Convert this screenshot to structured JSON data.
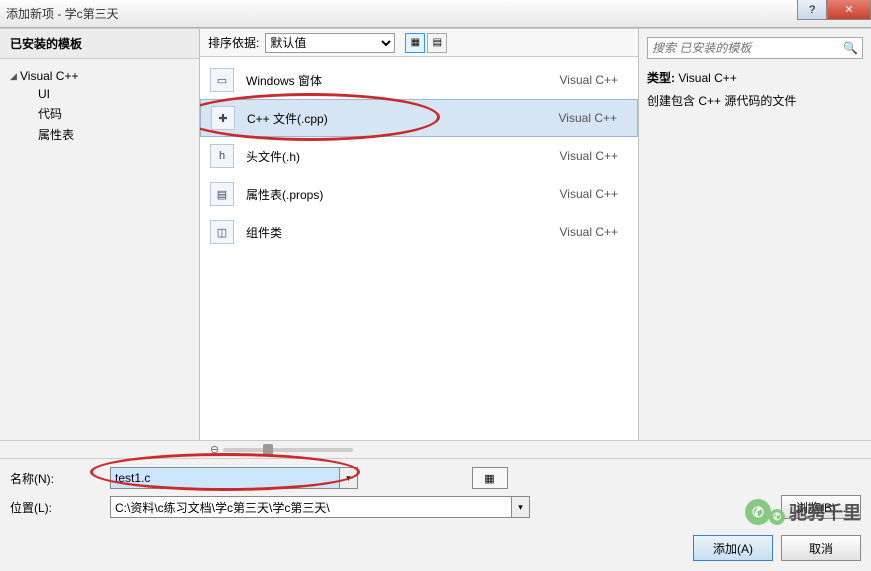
{
  "window": {
    "title": "添加新项 - 学c第三天"
  },
  "sidebar": {
    "header": "已安装的模板",
    "root": "Visual C++",
    "items": [
      {
        "label": "UI"
      },
      {
        "label": "代码"
      },
      {
        "label": "属性表"
      }
    ]
  },
  "toolbar": {
    "sort_label": "排序依据:",
    "sort_value": "默认值"
  },
  "templates": [
    {
      "icon": "▭",
      "label": "Windows 窗体",
      "lang": "Visual C++"
    },
    {
      "icon": "✚",
      "label": "C++ 文件(.cpp)",
      "lang": "Visual C++",
      "selected": true
    },
    {
      "icon": "h",
      "label": "头文件(.h)",
      "lang": "Visual C++"
    },
    {
      "icon": "▤",
      "label": "属性表(.props)",
      "lang": "Visual C++"
    },
    {
      "icon": "◫",
      "label": "组件类",
      "lang": "Visual C++"
    }
  ],
  "detail": {
    "search_placeholder": "搜索 已安装的模板",
    "type_label": "类型:",
    "type_value": "Visual C++",
    "description": "创建包含 C++ 源代码的文件"
  },
  "form": {
    "name_label": "名称(N):",
    "name_value": "test1.c",
    "location_label": "位置(L):",
    "location_value": "C:\\资料\\c练习文档\\学c第三天\\学c第三天\\",
    "browse_label": "浏览(B)..."
  },
  "buttons": {
    "add": "添加(A)",
    "cancel": "取消"
  },
  "watermark": {
    "text": "驰骋千里"
  }
}
